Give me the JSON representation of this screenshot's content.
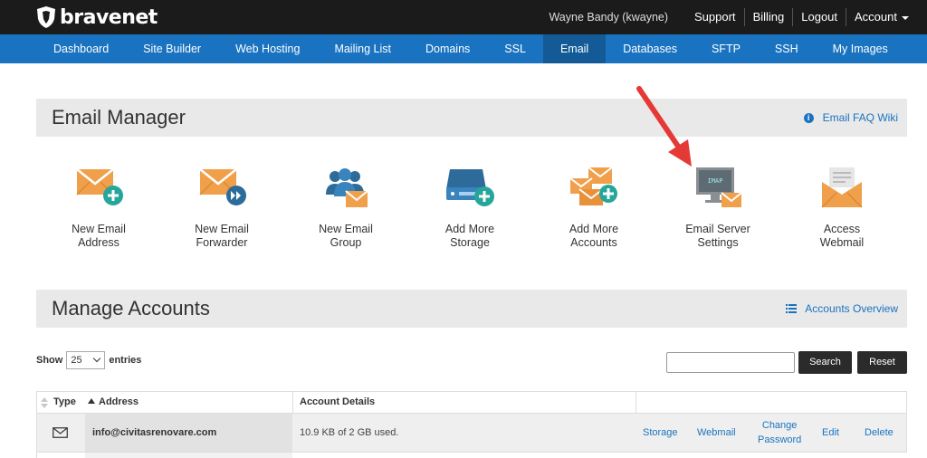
{
  "header": {
    "brand": "bravenet",
    "user": "Wayne Bandy (kwayne)",
    "links": [
      "Support",
      "Billing",
      "Logout",
      "Account"
    ]
  },
  "nav": {
    "tabs": [
      "Dashboard",
      "Site Builder",
      "Web Hosting",
      "Mailing List",
      "Domains",
      "SSL",
      "Email",
      "Databases",
      "SFTP",
      "SSH",
      "My Images"
    ],
    "active": "Email"
  },
  "email_manager": {
    "title": "Email Manager",
    "faq_link": "Email FAQ Wiki",
    "tiles": [
      {
        "line1": "New Email",
        "line2": "Address",
        "icon": "envelope-plus-icon"
      },
      {
        "line1": "New Email",
        "line2": "Forwarder",
        "icon": "envelope-forward-icon"
      },
      {
        "line1": "New Email",
        "line2": "Group",
        "icon": "group-envelope-icon"
      },
      {
        "line1": "Add More",
        "line2": "Storage",
        "icon": "storage-plus-icon"
      },
      {
        "line1": "Add More",
        "line2": "Accounts",
        "icon": "envelopes-plus-icon"
      },
      {
        "line1": "Email Server",
        "line2": "Settings",
        "icon": "imap-monitor-icon",
        "badge": "IMAP"
      },
      {
        "line1": "Access",
        "line2": "Webmail",
        "icon": "webmail-envelope-icon"
      }
    ]
  },
  "manage_accounts": {
    "title": "Manage Accounts",
    "overview_link": "Accounts Overview",
    "show_label": "Show",
    "entries_value": "25",
    "entries_label": "entries",
    "search_button": "Search",
    "reset_button": "Reset",
    "columns": [
      "Type",
      "Address",
      "Account Details"
    ],
    "rows": [
      {
        "address": "info@civitasrenovare.com",
        "details": "10.9 KB of 2 GB used.",
        "actions": [
          "Storage",
          "Webmail",
          "Change Password",
          "Edit",
          "Delete"
        ],
        "change_line1": "Change",
        "change_line2": "Password"
      }
    ]
  },
  "colors": {
    "nav_blue": "#1a73c0",
    "nav_active": "#135a97",
    "topbar": "#1b1b1b",
    "envelope_orange": "#f0a04b",
    "plus_teal": "#26a69a",
    "arrow_red": "#e53935"
  }
}
